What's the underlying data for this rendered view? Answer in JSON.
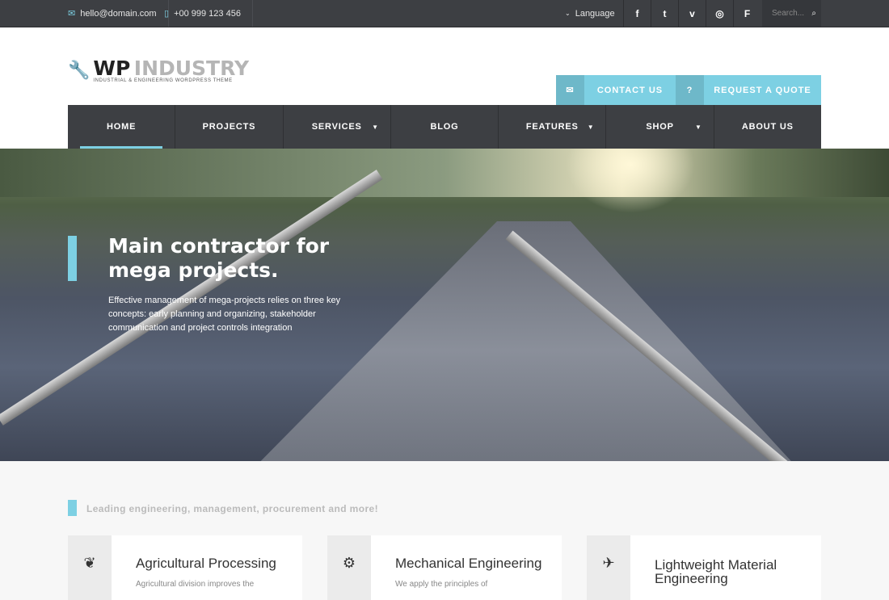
{
  "topbar": {
    "email": "hello@domain.com",
    "phone": "+00 999 123 456",
    "language": "Language",
    "search_placeholder": "Search...",
    "social": [
      {
        "icon": "facebook-icon",
        "glyph": "f"
      },
      {
        "icon": "twitter-icon",
        "glyph": "t"
      },
      {
        "icon": "vimeo-icon",
        "glyph": "v"
      },
      {
        "icon": "github-icon",
        "glyph": "◎"
      },
      {
        "icon": "foursquare-icon",
        "glyph": "F"
      }
    ]
  },
  "logo": {
    "word1": "WP",
    "word2": "INDUSTRY",
    "tagline": "INDUSTRIAL & ENGINEERING WORDPRESS THEME"
  },
  "cta": {
    "contact": "CONTACT US",
    "quote": "REQUEST A QUOTE"
  },
  "nav": [
    {
      "label": "HOME",
      "active": true
    },
    {
      "label": "PROJECTS"
    },
    {
      "label": "SERVICES",
      "dropdown": true
    },
    {
      "label": "BLOG"
    },
    {
      "label": "FEATURES",
      "dropdown": true
    },
    {
      "label": "SHOP",
      "dropdown": true
    },
    {
      "label": "ABOUT US"
    }
  ],
  "hero": {
    "title": "Main contractor for mega projects.",
    "text": "Effective management of mega-projects relies on three key concepts: early planning and organizing, stakeholder communication and project controls integration"
  },
  "lead": "Leading engineering, management, procurement and more!",
  "cards": [
    {
      "icon": "leaf-icon",
      "title": "Agricultural Processing",
      "text": "Agricultural division improves the"
    },
    {
      "icon": "gears-icon",
      "title": "Mechanical Engineering",
      "text": "We apply the principles of"
    },
    {
      "icon": "plane-icon",
      "title": "Lightweight Material Engineering",
      "text": ""
    }
  ],
  "colors": {
    "accent": "#7dd0e3",
    "dark": "#3d3f43"
  }
}
